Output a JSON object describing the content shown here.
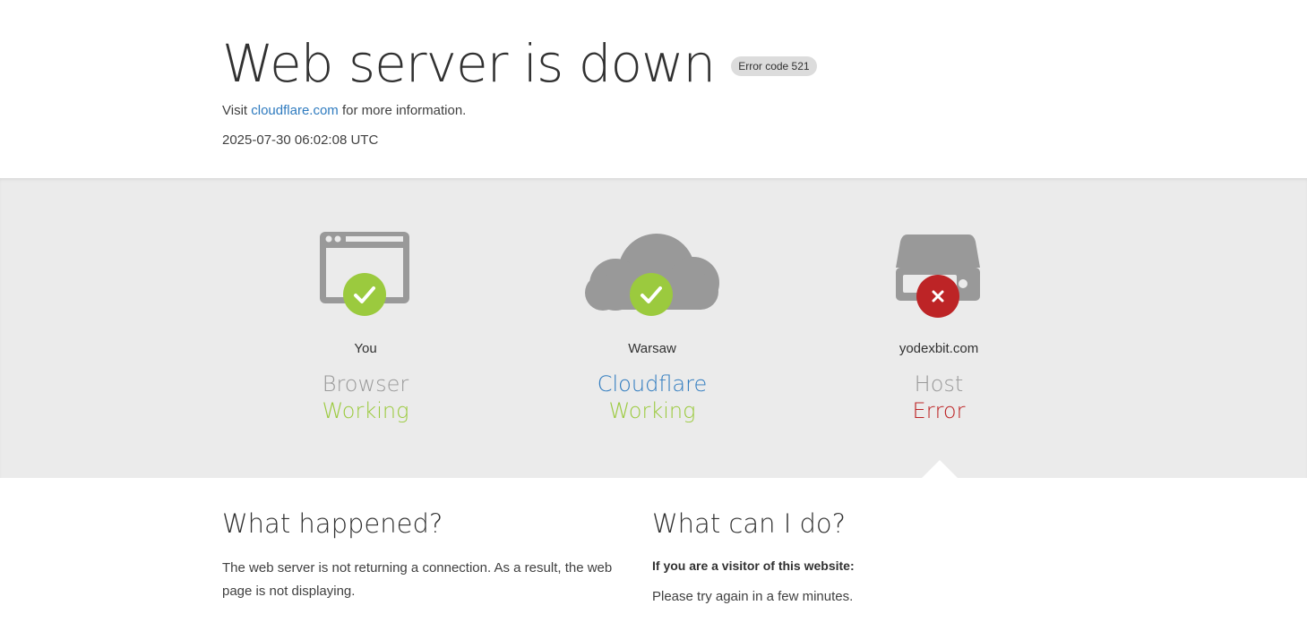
{
  "header": {
    "title": "Web server is down",
    "badge": "Error code 521",
    "visit_prefix": "Visit",
    "visit_link": "cloudflare.com",
    "visit_suffix": "for more information.",
    "timestamp": "2025-07-30 06:02:08 UTC"
  },
  "status": [
    {
      "location": "You",
      "role": "Browser",
      "state": "Working",
      "icon": "browser-icon",
      "status_icon": "check-icon"
    },
    {
      "location": "Warsaw",
      "role": "Cloudflare",
      "state": "Working",
      "icon": "cloud-icon",
      "status_icon": "check-icon"
    },
    {
      "location": "yodexbit.com",
      "role": "Host",
      "state": "Error",
      "icon": "server-icon",
      "status_icon": "x-icon"
    }
  ],
  "what_happened": {
    "title": "What happened?",
    "text": "The web server is not returning a connection. As a result, the web page is not displaying."
  },
  "what_can_i_do": {
    "title": "What can I do?",
    "visitor_label": "If you are a visitor of this website:",
    "visitor_text": "Please try again in a few minutes."
  },
  "colors": {
    "ok": "#9bca3e",
    "error": "#bd2426",
    "link": "#2f7bbf",
    "band": "#ebebeb",
    "icon_gray": "#999999"
  }
}
